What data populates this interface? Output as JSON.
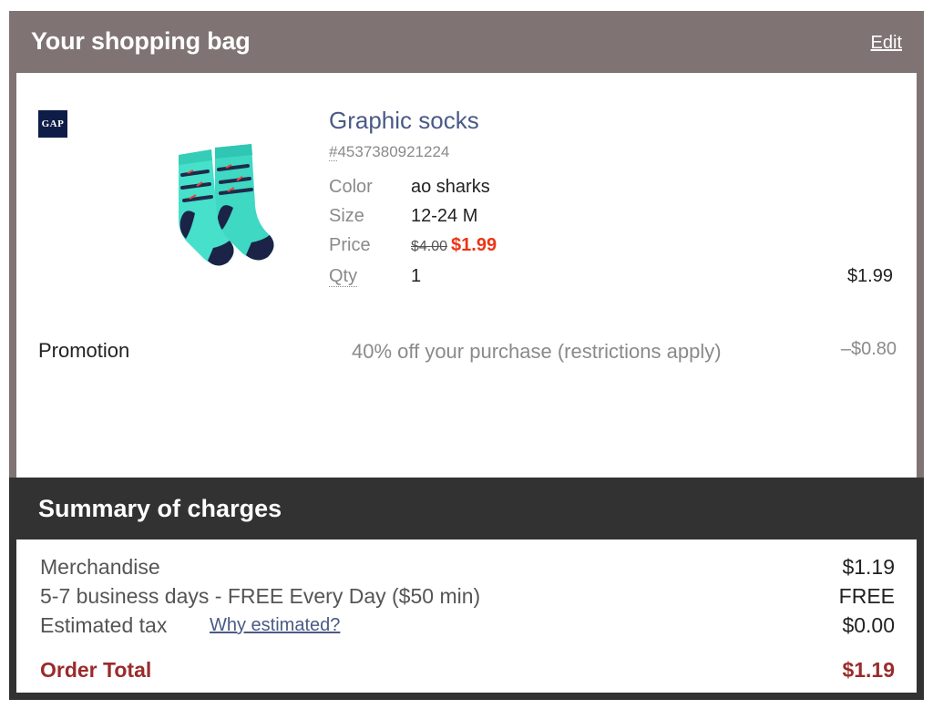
{
  "bag": {
    "title": "Your shopping bag",
    "edit_label": "Edit"
  },
  "brand": {
    "logo_text": "GAP"
  },
  "item": {
    "name": "Graphic socks",
    "sku_hash": "#",
    "sku": "4537380921224",
    "image_icon": "shark-socks-image",
    "attributes": {
      "color_label": "Color",
      "color_value": "ao sharks",
      "size_label": "Size",
      "size_value": "12-24 M",
      "price_label": "Price",
      "price_original": "$4.00",
      "price_sale": "$1.99",
      "qty_label": "Qty",
      "qty_value": "1"
    },
    "line_total": "$1.99"
  },
  "promotion": {
    "label": "Promotion",
    "description": "40% off your purchase (restrictions apply)",
    "amount": "–$0.80"
  },
  "summary": {
    "title": "Summary of charges",
    "merchandise_label": "Merchandise",
    "merchandise_value": "$1.19",
    "shipping_label": "5-7 business days - FREE Every Day ($50 min)",
    "shipping_value": "FREE",
    "tax_label": "Estimated tax",
    "tax_link": "Why estimated?",
    "tax_value": "$0.00",
    "total_label": "Order Total",
    "total_value": "$1.19"
  },
  "colors": {
    "bag_header_bg": "#7f7473",
    "summary_header_bg": "#323232",
    "sale_price": "#ec3516",
    "order_total": "#9b2b2b",
    "link": "#4a5a86"
  }
}
